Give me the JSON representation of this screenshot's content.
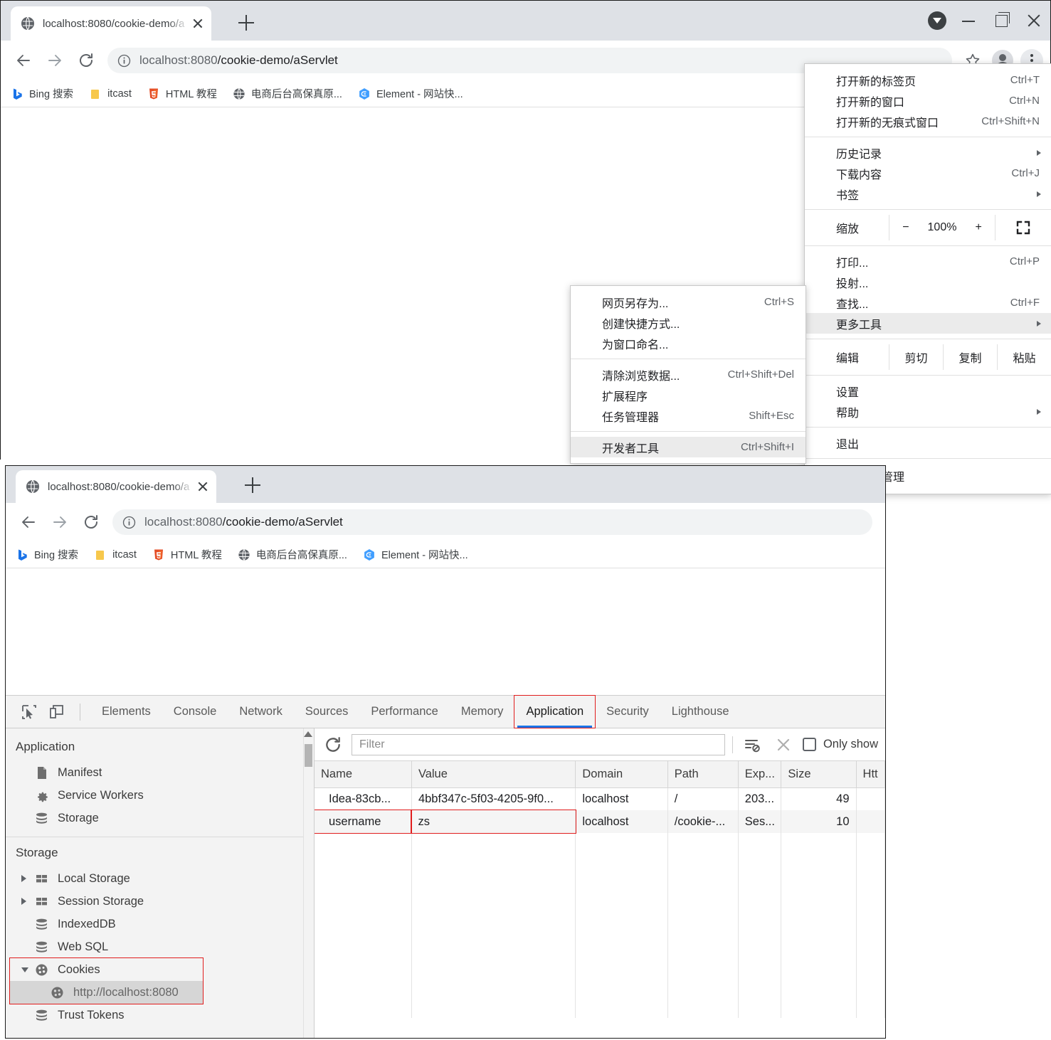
{
  "window_top": {
    "tab": {
      "title": "localhost:8080/cookie-demo/a",
      "favicon": "globe-icon",
      "close": "close-icon"
    },
    "new_tab_label": "+",
    "window_controls": {
      "download": "download-badge-icon",
      "minimize": "minimize-icon",
      "maximize": "restore-icon",
      "close": "close-icon"
    },
    "toolbar": {
      "back": "back-arrow-icon",
      "forward": "forward-arrow-icon",
      "reload": "reload-icon",
      "info": "info-circle-icon",
      "url_scheme": "localhost:8080",
      "url_path": "/cookie-demo/aServlet",
      "url_full": "localhost:8080/cookie-demo/aServlet",
      "star": "bookmark-star-icon",
      "profile": "avatar-icon",
      "menu": "kebab-menu-icon"
    },
    "bookmarks": [
      {
        "label": "Bing 搜索",
        "icon": "bing-icon"
      },
      {
        "label": "itcast",
        "icon": "folder-icon"
      },
      {
        "label": "HTML 教程",
        "icon": "html5-icon"
      },
      {
        "label": "电商后台高保真原...",
        "icon": "globe-icon"
      },
      {
        "label": "Element - 网站快...",
        "icon": "element-hexagon-icon"
      }
    ]
  },
  "chrome_menu": {
    "groups": [
      [
        {
          "label": "打开新的标签页",
          "accel": "Ctrl+T"
        },
        {
          "label": "打开新的窗口",
          "accel": "Ctrl+N"
        },
        {
          "label": "打开新的无痕式窗口",
          "accel": "Ctrl+Shift+N"
        }
      ],
      [
        {
          "label": "历史记录",
          "accel": "",
          "submenu": true
        },
        {
          "label": "下载内容",
          "accel": "Ctrl+J"
        },
        {
          "label": "书签",
          "accel": "",
          "submenu": true
        }
      ]
    ],
    "zoom_row": {
      "label": "缩放",
      "minus": "−",
      "value": "100%",
      "plus": "+",
      "fullscreen": "fullscreen-icon"
    },
    "group3": [
      {
        "label": "打印...",
        "accel": "Ctrl+P"
      },
      {
        "label": "投射...",
        "accel": ""
      },
      {
        "label": "查找...",
        "accel": "Ctrl+F"
      },
      {
        "label": "更多工具",
        "accel": "",
        "submenu": true,
        "selected": true
      }
    ],
    "edit_row": {
      "label": "编辑",
      "cut": "剪切",
      "copy": "复制",
      "paste": "粘贴"
    },
    "group4": [
      {
        "label": "设置",
        "accel": ""
      },
      {
        "label": "帮助",
        "accel": "",
        "submenu": true
      }
    ],
    "group5": [
      {
        "label": "退出",
        "accel": ""
      }
    ],
    "managed": {
      "label": "由贵单位管理",
      "icon": "building-icon"
    }
  },
  "more_tools_submenu": {
    "groups": [
      [
        {
          "label": "网页另存为...",
          "accel": "Ctrl+S"
        },
        {
          "label": "创建快捷方式...",
          "accel": ""
        },
        {
          "label": "为窗口命名...",
          "accel": ""
        }
      ],
      [
        {
          "label": "清除浏览数据...",
          "accel": "Ctrl+Shift+Del"
        },
        {
          "label": "扩展程序",
          "accel": ""
        },
        {
          "label": "任务管理器",
          "accel": "Shift+Esc"
        }
      ],
      [
        {
          "label": "开发者工具",
          "accel": "Ctrl+Shift+I",
          "selected": true
        }
      ]
    ]
  },
  "window_bottom": {
    "tab": {
      "title": "localhost:8080/cookie-demo/a",
      "favicon": "globe-icon",
      "close": "close-icon"
    },
    "new_tab_label": "+",
    "toolbar": {
      "back": "back-arrow-icon",
      "forward": "forward-arrow-icon",
      "reload": "reload-icon",
      "info": "info-circle-icon",
      "url_scheme": "localhost:8080",
      "url_path": "/cookie-demo/aServlet",
      "url_full": "localhost:8080/cookie-demo/aServlet"
    },
    "bookmarks": [
      {
        "label": "Bing 搜索",
        "icon": "bing-icon"
      },
      {
        "label": "itcast",
        "icon": "folder-icon"
      },
      {
        "label": "HTML 教程",
        "icon": "html5-icon"
      },
      {
        "label": "电商后台高保真原...",
        "icon": "globe-icon"
      },
      {
        "label": "Element - 网站快...",
        "icon": "element-hexagon-icon"
      }
    ]
  },
  "devtools": {
    "left_icons": [
      "inspect-element-icon",
      "device-toolbar-icon"
    ],
    "tabs": [
      {
        "label": "Elements",
        "active": false
      },
      {
        "label": "Console",
        "active": false
      },
      {
        "label": "Network",
        "active": false
      },
      {
        "label": "Sources",
        "active": false
      },
      {
        "label": "Performance",
        "active": false
      },
      {
        "label": "Memory",
        "active": false
      },
      {
        "label": "Application",
        "active": true,
        "highlighted": true
      },
      {
        "label": "Security",
        "active": false
      },
      {
        "label": "Lighthouse",
        "active": false
      }
    ],
    "sidebar": {
      "section1_title": "Application",
      "section1_items": [
        {
          "label": "Manifest",
          "icon": "document-icon"
        },
        {
          "label": "Service Workers",
          "icon": "gear-icon"
        },
        {
          "label": "Storage",
          "icon": "database-icon"
        }
      ],
      "section2_title": "Storage",
      "section2_items": [
        {
          "label": "Local Storage",
          "icon": "table-icon",
          "twisty": "collapsed"
        },
        {
          "label": "Session Storage",
          "icon": "table-icon",
          "twisty": "collapsed"
        },
        {
          "label": "IndexedDB",
          "icon": "database-icon"
        },
        {
          "label": "Web SQL",
          "icon": "database-icon"
        },
        {
          "label": "Cookies",
          "icon": "cookie-icon",
          "twisty": "expanded",
          "highlighted": true
        },
        {
          "label": "http://localhost:8080",
          "icon": "cookie-icon",
          "sub": true,
          "selected": true,
          "highlighted": true
        },
        {
          "label": "Trust Tokens",
          "icon": "database-icon"
        }
      ]
    },
    "cookie_toolbar": {
      "refresh": "refresh-icon",
      "filter_placeholder": "Filter",
      "clear_all": "clear-all-cookies-icon",
      "delete": "delete-x-icon",
      "only_show_label": "Only show",
      "only_show_checked": false
    },
    "cookie_table": {
      "columns": [
        "Name",
        "Value",
        "Domain",
        "Path",
        "Exp...",
        "Size",
        "Htt"
      ],
      "rows": [
        {
          "name": "Idea-83cb...",
          "value": "4bbf347c-5f03-4205-9f0...",
          "domain": "localhost",
          "path": "/",
          "expires": "203...",
          "size": "49",
          "http": ""
        },
        {
          "name": "username",
          "value": "zs",
          "domain": "localhost",
          "path": "/cookie-...",
          "expires": "Ses...",
          "size": "10",
          "http": "",
          "highlighted": true
        }
      ]
    }
  },
  "colors": {
    "accent_blue": "#1a73e8",
    "highlight_red": "#e11d1d",
    "tabstrip_grey": "#dee1e6",
    "devtools_grey": "#f3f3f3"
  }
}
